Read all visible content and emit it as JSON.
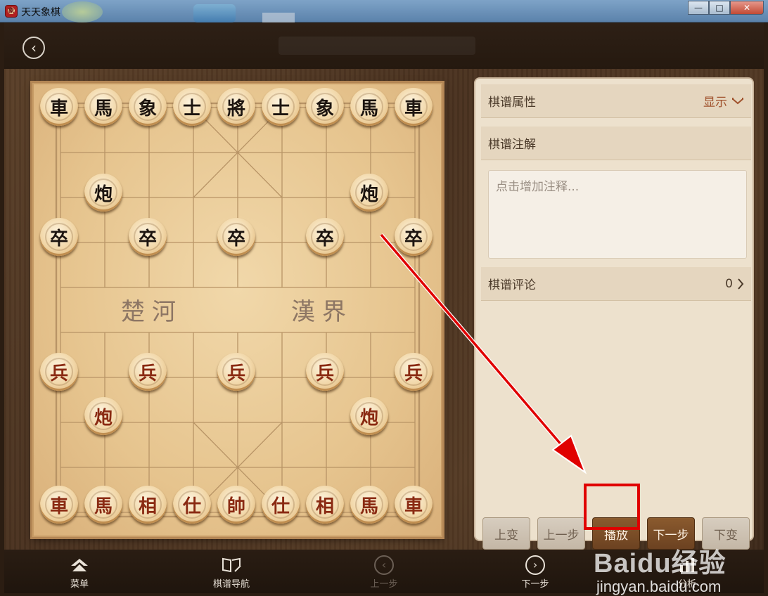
{
  "window": {
    "title": "天天象棋",
    "app_icon_glyph": "象",
    "minimize": "—",
    "maximize": "□",
    "close": "✕"
  },
  "topbar": {
    "back_icon": "‹"
  },
  "board": {
    "river_left": "楚河",
    "river_right": "漢界",
    "pieces": {
      "b_che1": "車",
      "b_ma1": "馬",
      "b_xiang1": "象",
      "b_shi1": "士",
      "b_jiang": "將",
      "b_shi2": "士",
      "b_xiang2": "象",
      "b_ma2": "馬",
      "b_che2": "車",
      "b_pao1": "炮",
      "b_pao2": "炮",
      "b_zu1": "卒",
      "b_zu2": "卒",
      "b_zu3": "卒",
      "b_zu4": "卒",
      "b_zu5": "卒",
      "r_bing1": "兵",
      "r_bing2": "兵",
      "r_bing3": "兵",
      "r_bing4": "兵",
      "r_bing5": "兵",
      "r_pao1": "炮",
      "r_pao2": "炮",
      "r_che1": "車",
      "r_ma1": "馬",
      "r_xiang1": "相",
      "r_shi1": "仕",
      "r_shuai": "帥",
      "r_shi2": "仕",
      "r_xiang2": "相",
      "r_ma2": "馬",
      "r_che2": "車"
    }
  },
  "panel": {
    "properties_label": "棋谱属性",
    "properties_toggle": "显示",
    "annotation_label": "棋谱注解",
    "annotation_placeholder": "点击增加注释...",
    "comments_label": "棋谱评论",
    "comments_count": "0",
    "buttons": {
      "prev_variation": "上变",
      "prev_step": "上一步",
      "play": "播放",
      "next_step": "下一步",
      "next_variation": "下变"
    }
  },
  "bottombar": {
    "menu": "菜单",
    "navigation": "棋谱导航",
    "prev": "上一步",
    "next": "下一步",
    "analysis": "分析"
  },
  "watermark": {
    "main": "Baidu经验",
    "sub": "jingyan.baidu.com"
  },
  "colors": {
    "accent_red": "#e00000",
    "play_button": "#6c4221",
    "board": "#e6c48e"
  }
}
